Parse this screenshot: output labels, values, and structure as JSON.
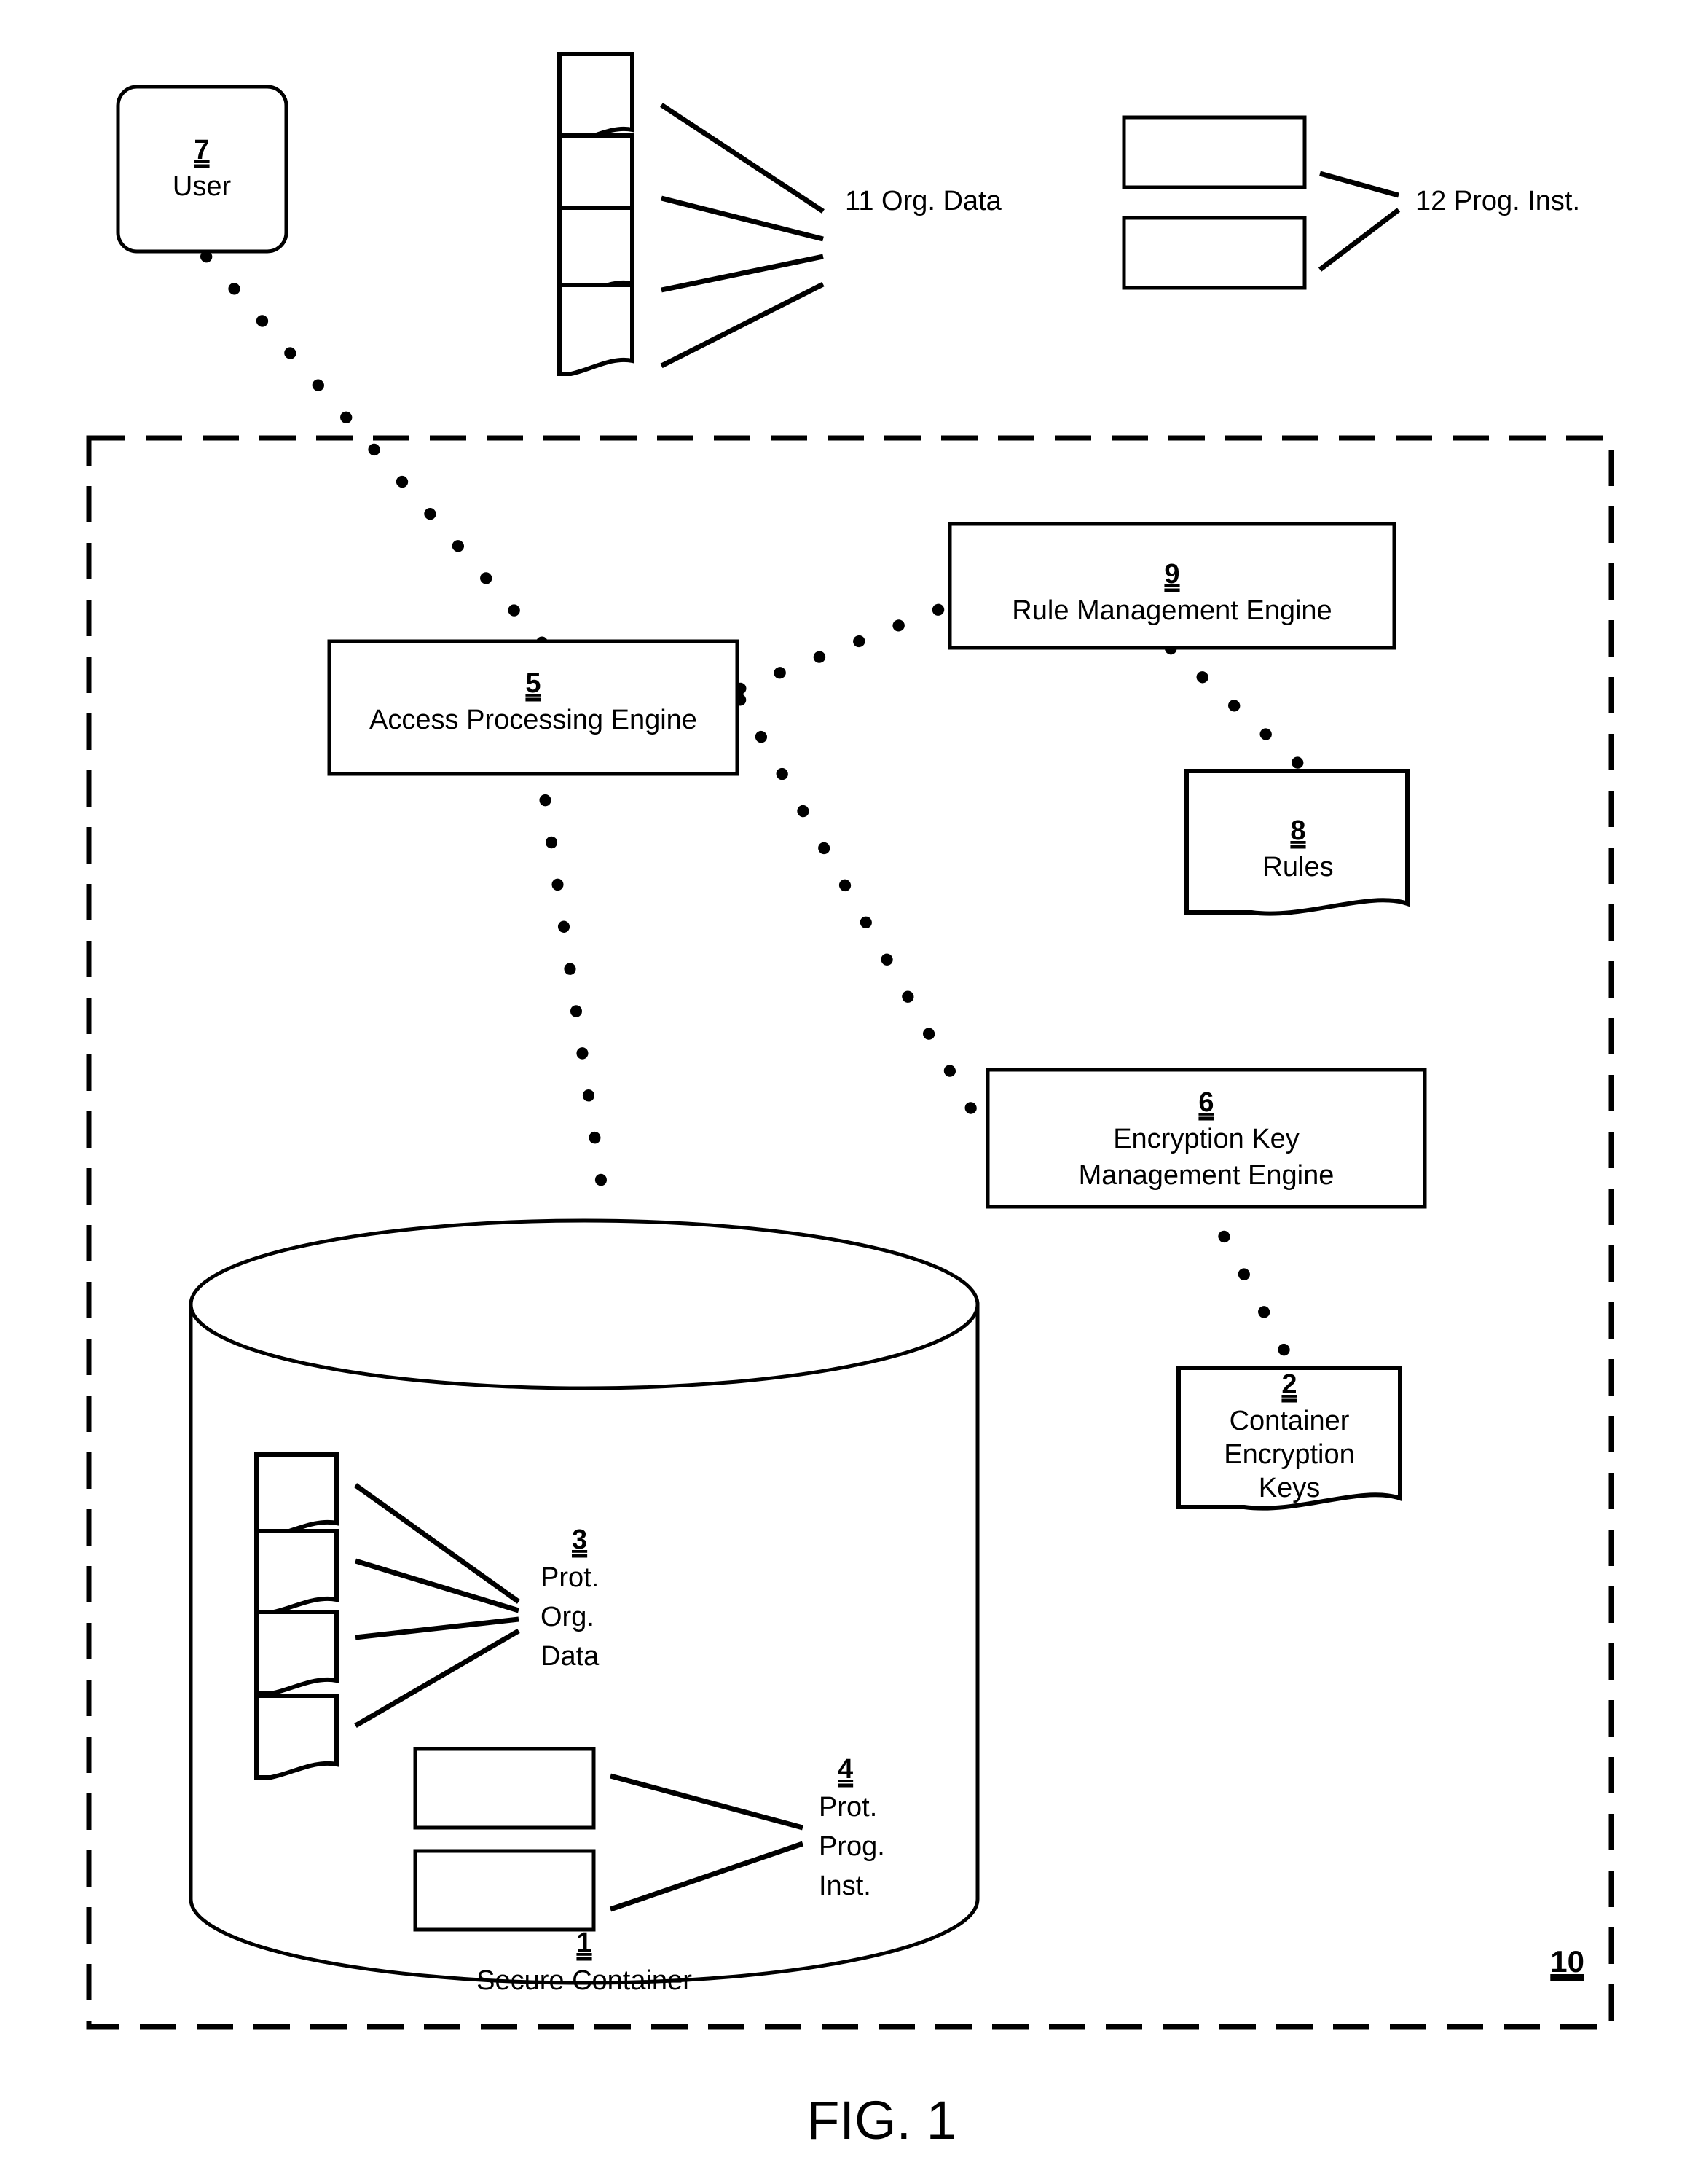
{
  "figure": {
    "caption": "FIG. 1",
    "system_ref": "10"
  },
  "external": {
    "user": {
      "ref": "7",
      "label": "User"
    },
    "org_data": {
      "label": "11 Org. Data",
      "doc_count": 4
    },
    "prog_inst": {
      "label": "12 Prog. Inst.",
      "box_count": 2
    }
  },
  "system": {
    "access_processing_engine": {
      "ref": "5",
      "label": "Access Processing Engine"
    },
    "rule_management_engine": {
      "ref": "9",
      "label": "Rule Management Engine"
    },
    "rules": {
      "ref": "8",
      "label": "Rules"
    },
    "encryption_key_management_engine": {
      "ref": "6",
      "label_line1": "Encryption Key",
      "label_line2": "Management Engine"
    },
    "container_encryption_keys": {
      "ref": "2",
      "label_line1": "Container",
      "label_line2": "Encryption",
      "label_line3": "Keys"
    },
    "secure_container": {
      "ref": "1",
      "label": "Secure Container",
      "prot_org_data": {
        "ref": "3",
        "label_line1": "Prot.",
        "label_line2": "Org.",
        "label_line3": "Data",
        "doc_count": 4
      },
      "prot_prog_inst": {
        "ref": "4",
        "label_line1": "Prot.",
        "label_line2": "Prog.",
        "label_line3": "Inst.",
        "box_count": 2
      }
    }
  },
  "colors": {
    "ink": "#000000",
    "paper": "#ffffff"
  }
}
